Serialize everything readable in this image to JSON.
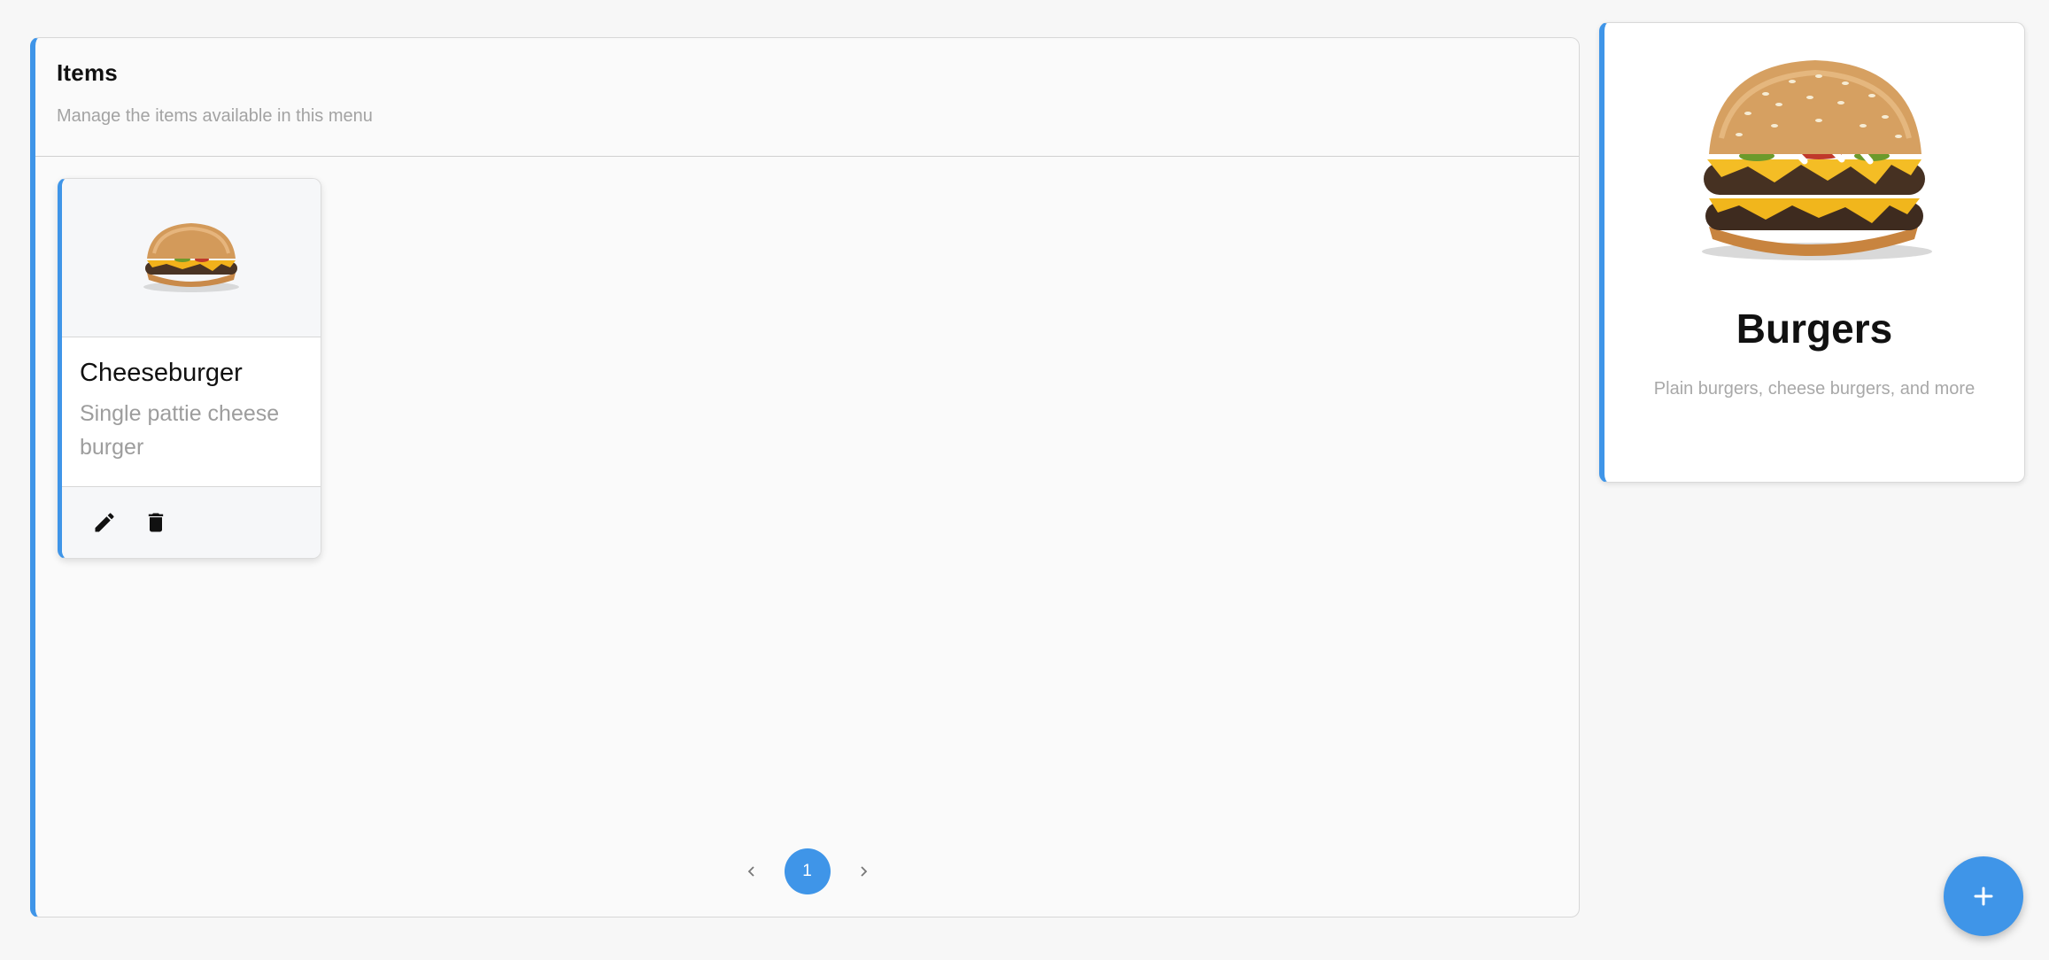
{
  "items_panel": {
    "title": "Items",
    "subtitle": "Manage the items available in this menu"
  },
  "items": [
    {
      "name": "Cheeseburger",
      "description": "Single pattie cheese burger",
      "image_icon": "cheeseburger-image",
      "actions": [
        "edit-icon",
        "delete-icon"
      ]
    }
  ],
  "pagination": {
    "current_page": "1",
    "prev_icon": "chevron-left-icon",
    "next_icon": "chevron-right-icon"
  },
  "category": {
    "name": "Burgers",
    "description": "Plain burgers, cheese burgers, and more",
    "image_icon": "double-cheeseburger-image"
  },
  "fab": {
    "icon": "plus-icon"
  },
  "colors": {
    "accent": "#3f95e8",
    "background": "#f7f7f7",
    "muted_text": "#a3a3a3"
  }
}
